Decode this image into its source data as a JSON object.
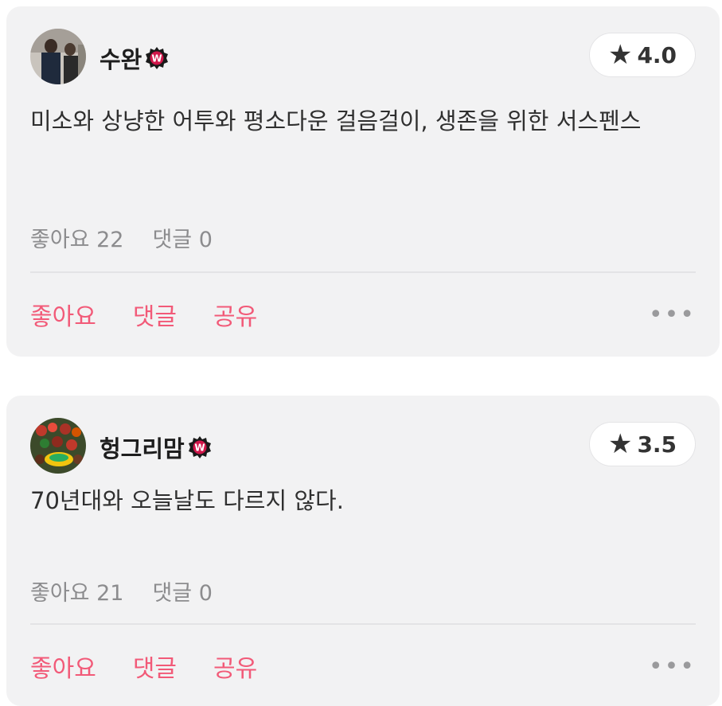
{
  "colors": {
    "accent": "#f25a78",
    "card_bg": "#f2f2f3",
    "badge": "#d0164a"
  },
  "reviews": [
    {
      "username": "수완",
      "badge_icon": "watcha-badge-icon",
      "rating_icon": "star-icon",
      "rating": "4.0",
      "text": "미소와 상냥한 어투와 평소다운 걸음걸이, 생존을 위한 서스펜스",
      "likes_label": "좋아요 22",
      "comments_label": "댓글 0",
      "actions": {
        "like": "좋아요",
        "comment": "댓글",
        "share": "공유",
        "more": "•••"
      }
    },
    {
      "username": "헝그리맘",
      "badge_icon": "watcha-badge-icon",
      "rating_icon": "star-icon",
      "rating": "3.5",
      "text": "70년대와 오늘날도 다르지 않다.",
      "likes_label": "좋아요 21",
      "comments_label": "댓글 0",
      "actions": {
        "like": "좋아요",
        "comment": "댓글",
        "share": "공유",
        "more": "•••"
      }
    }
  ]
}
